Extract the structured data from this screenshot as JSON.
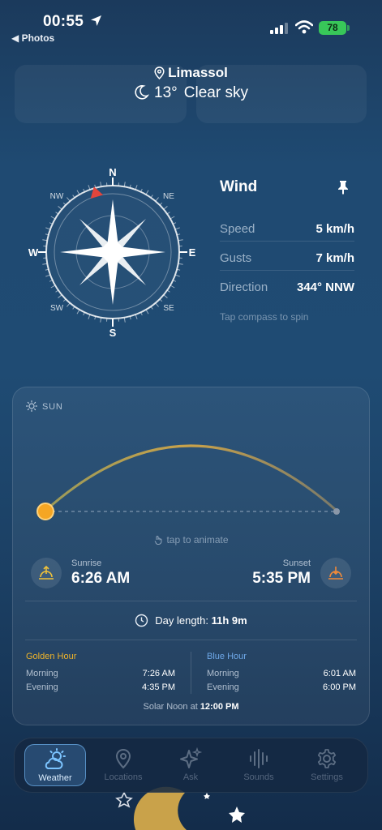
{
  "status": {
    "time": "00:55",
    "back": "◀ Photos",
    "battery": "78"
  },
  "header": {
    "location": "Limassol",
    "temp": "13°",
    "condition": "Clear sky"
  },
  "compass": {
    "n": "N",
    "ne": "NE",
    "e": "E",
    "se": "SE",
    "s": "S",
    "sw": "SW",
    "w": "W",
    "nw": "NW",
    "needle_deg": 344
  },
  "wind": {
    "title": "Wind",
    "rows": [
      {
        "label": "Speed",
        "value": "5 km/h"
      },
      {
        "label": "Gusts",
        "value": "7 km/h"
      },
      {
        "label": "Direction",
        "value": "344° NNW"
      }
    ],
    "hint": "Tap compass to spin"
  },
  "sun": {
    "title": "SUN",
    "tap_hint": "tap to animate",
    "sunrise_label": "Sunrise",
    "sunrise": "6:26 AM",
    "sunset_label": "Sunset",
    "sunset": "5:35 PM",
    "day_length_label": "Day length:",
    "day_length": "11h 9m",
    "golden": {
      "title": "Golden Hour",
      "morning_label": "Morning",
      "morning": "7:26 AM",
      "evening_label": "Evening",
      "evening": "4:35 PM"
    },
    "blue": {
      "title": "Blue Hour",
      "morning_label": "Morning",
      "morning": "6:01 AM",
      "evening_label": "Evening",
      "evening": "6:00 PM"
    },
    "noon_label": "Solar Noon at",
    "noon": "12:00 PM"
  },
  "colors": {
    "golden": "#f0b429",
    "blue": "#6fa8e8",
    "sun": "#f5a623"
  },
  "tabs": [
    {
      "label": "Weather",
      "icon": "weather-icon"
    },
    {
      "label": "Locations",
      "icon": "location-pin-icon"
    },
    {
      "label": "Ask",
      "icon": "sparkle-icon"
    },
    {
      "label": "Sounds",
      "icon": "waveform-icon"
    },
    {
      "label": "Settings",
      "icon": "gear-icon"
    }
  ]
}
